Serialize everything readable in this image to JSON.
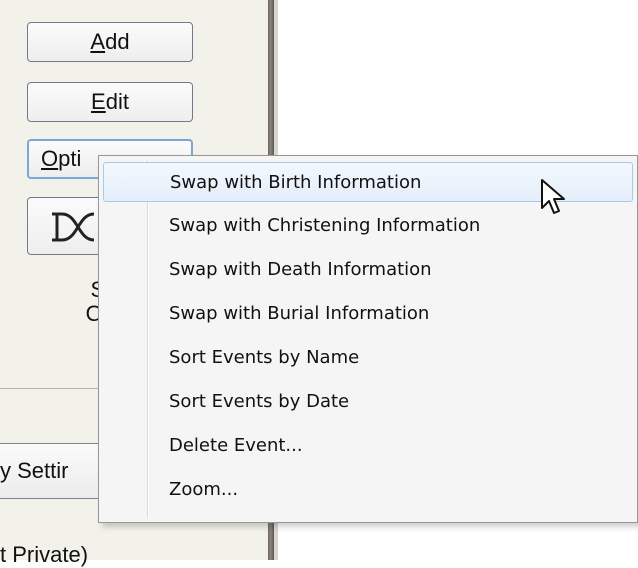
{
  "side_panel": {
    "buttons": {
      "add": {
        "prefix": "",
        "accel": "A",
        "rest": "dd"
      },
      "edit": {
        "prefix": "",
        "accel": "E",
        "rest": "dit"
      },
      "options": {
        "prefix": "",
        "accel": "O",
        "rest": "pti"
      }
    },
    "sort_label_line1": "Se",
    "sort_label_line2": "Ord",
    "privacy_button_label": "y Settir",
    "bottom_text": "t Private)"
  },
  "context_menu": {
    "items": [
      {
        "label": "Swap with Birth Information",
        "highlighted": true
      },
      {
        "label": "Swap with Christening Information",
        "highlighted": false
      },
      {
        "label": "Swap with Death Information",
        "highlighted": false
      },
      {
        "label": "Swap with Burial Information",
        "highlighted": false
      },
      {
        "label": "Sort Events by Name",
        "highlighted": false
      },
      {
        "label": "Sort Events by Date",
        "highlighted": false
      },
      {
        "label": "Delete Event...",
        "highlighted": false
      },
      {
        "label": "Zoom...",
        "highlighted": false
      }
    ]
  },
  "icons": {
    "dna_button": "dna-icon",
    "cursor": "arrow-cursor-icon"
  },
  "colors": {
    "panel_bg": "#f2f1ea",
    "menu_bg": "#f5f5f5",
    "menu_highlight_border": "#a8c9ea",
    "options_focus_border": "#7aa6d8"
  }
}
